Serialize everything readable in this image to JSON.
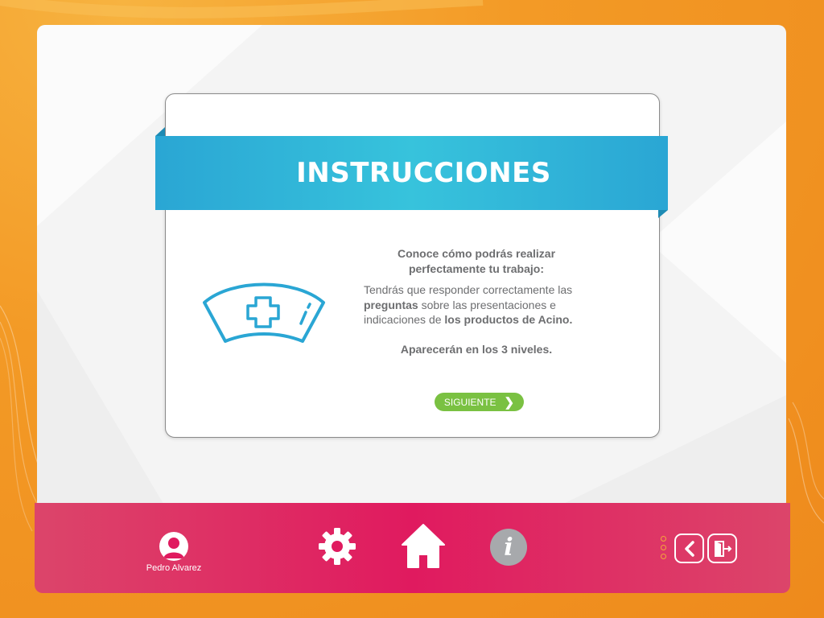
{
  "card": {
    "title": "INSTRUCCIONES",
    "intro": "Conoce cómo podrás realizar perfectamente tu trabajo:",
    "desc_parts": {
      "p1": "Tendrás que responder correctamente las ",
      "b1": "preguntas",
      "p2": " sobre las presentaciones e indicaciones de ",
      "b2": "los productos de Acino."
    },
    "niveles": "Aparecerán en los 3 niveles.",
    "next_button": "SIGUIENTE",
    "icon": "nurse-cap-icon"
  },
  "footer": {
    "user_name": "Pedro Alvarez",
    "icons": [
      "user-avatar-icon",
      "gear-icon",
      "home-icon",
      "info-icon",
      "back-icon",
      "exit-icon"
    ],
    "info_glyph": "i"
  },
  "colors": {
    "background": "#f39a26",
    "banner": "#2aa6d4",
    "button_green": "#7ac142",
    "footer": "#e01a5f",
    "text": "#6d6e70"
  }
}
